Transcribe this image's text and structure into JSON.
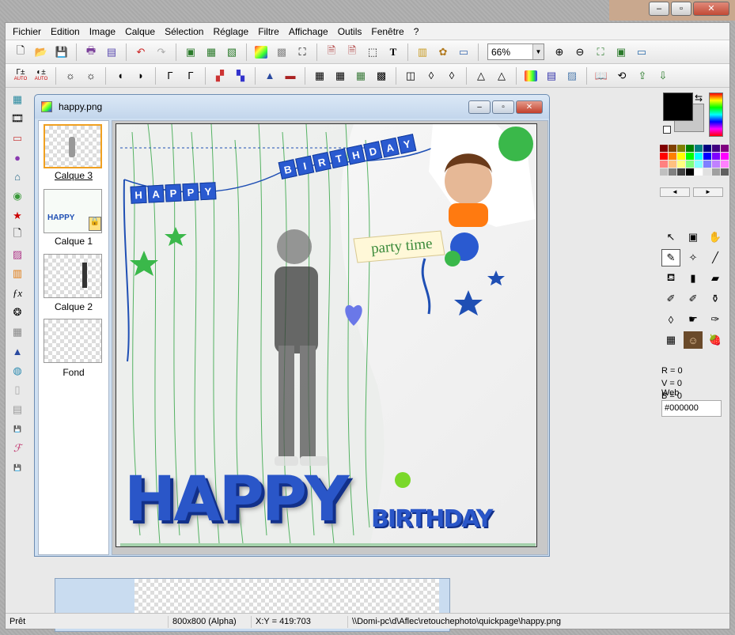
{
  "menubar": [
    "Fichier",
    "Edition",
    "Image",
    "Calque",
    "Sélection",
    "Réglage",
    "Filtre",
    "Affichage",
    "Outils",
    "Fenêtre",
    "?"
  ],
  "toolbar1": {
    "zoom_value": "66%",
    "buttons": [
      "new-icon",
      "open-icon",
      "save-icon",
      "print-icon",
      "scanner-icon",
      "undo-icon",
      "redo-icon",
      "copy-icon",
      "paste-icon",
      "paste-new-icon",
      "colors-icon",
      "gray-icon",
      "crop-icon",
      "text-icon"
    ]
  },
  "toolbar2": {
    "auto1": "AUTO",
    "auto2": "AUTO"
  },
  "document": {
    "title": "happy.png"
  },
  "layers": [
    {
      "label": "Calque 3",
      "selected": true
    },
    {
      "label": "Calque 1",
      "selected": false
    },
    {
      "label": "Calque 2",
      "selected": false
    },
    {
      "label": "Fond",
      "selected": false
    }
  ],
  "artwork": {
    "banner_top": "HAPPY BIRTHDAY",
    "banner_letters": [
      "H",
      "A",
      "P",
      "P",
      "Y",
      "B",
      "I",
      "R",
      "T",
      "H",
      "D",
      "A",
      "Y"
    ],
    "party_label": "party time",
    "big_happy": "HAPPY",
    "big_birthday": "BIRTHDAY"
  },
  "colors": {
    "r_label": "R = 0",
    "v_label": "V = 0",
    "b_label": "B = 0",
    "web_label": "Web",
    "web_value": "#000000",
    "palette": [
      "#800000",
      "#804000",
      "#808000",
      "#008000",
      "#008080",
      "#000080",
      "#400080",
      "#800080",
      "#ff0000",
      "#ff8000",
      "#ffff00",
      "#00ff00",
      "#00ffff",
      "#0000ff",
      "#8000ff",
      "#ff00ff",
      "#ff8080",
      "#ffc080",
      "#ffff80",
      "#80ff80",
      "#80ffff",
      "#8080ff",
      "#c080ff",
      "#ff80ff",
      "#c0c0c0",
      "#808080",
      "#404040",
      "#000000",
      "#ffffff",
      "#e0e0e0",
      "#a0a0a0",
      "#606060"
    ]
  },
  "status": {
    "ready": "Prêt",
    "size": "800x800 (Alpha)",
    "coords": "X:Y = 419:703",
    "path": "\\\\Domi-pc\\d\\Aflec\\retouchephoto\\quickpage\\happy.png"
  },
  "accent": "#1f4fb4"
}
